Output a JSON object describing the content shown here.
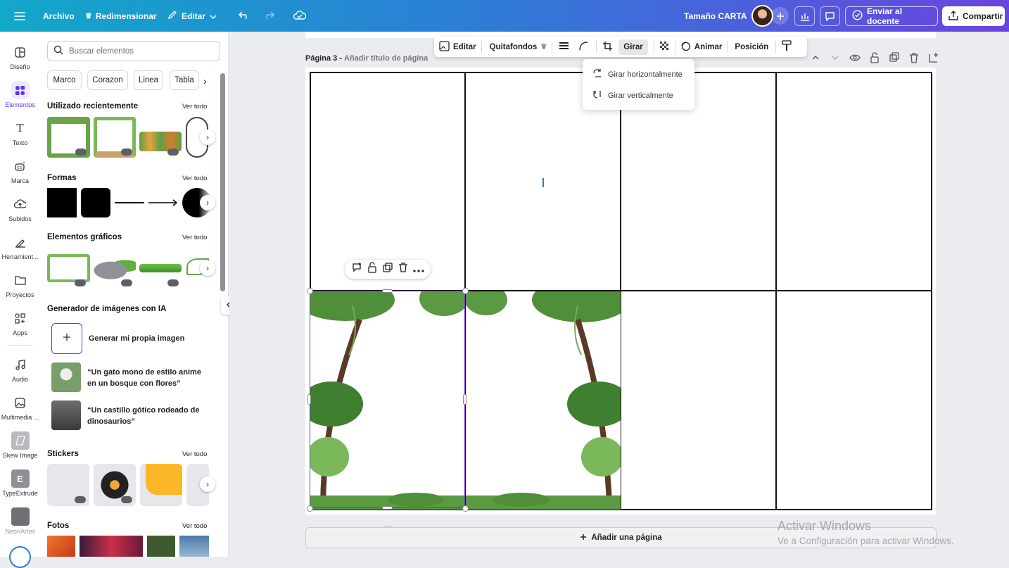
{
  "topbar": {
    "file": "Archivo",
    "resize": "Redimensionar",
    "edit": "Editar",
    "size_name": "Tamaño CARTA",
    "send": "Enviar al docente",
    "share": "Compartir"
  },
  "rail": [
    {
      "label": "Diseño",
      "icon": "layout-icon"
    },
    {
      "label": "Elementos",
      "icon": "elements-icon"
    },
    {
      "label": "Texto",
      "icon": "text-icon"
    },
    {
      "label": "Marca",
      "icon": "brand-icon"
    },
    {
      "label": "Subidos",
      "icon": "upload-icon"
    },
    {
      "label": "Herramient...",
      "icon": "tools-icon"
    },
    {
      "label": "Proyectos",
      "icon": "folder-icon"
    },
    {
      "label": "Apps",
      "icon": "apps-icon"
    },
    {
      "label": "Audio",
      "icon": "music-icon"
    },
    {
      "label": "Multimedia ...",
      "icon": "media-icon"
    },
    {
      "label": "Skew Image",
      "icon": "skew-icon"
    },
    {
      "label": "TypeExtrude",
      "icon": "typeextrude-icon"
    },
    {
      "label": "NeonArtist",
      "icon": "neonartist-icon"
    }
  ],
  "panel": {
    "search_placeholder": "Buscar elementos",
    "chips": [
      "Marco",
      "Corazon",
      "Linea",
      "Tabla"
    ],
    "recent_title": "Utilizado recientemente",
    "shapes_title": "Formas",
    "graphics_title": "Elementos gráficos",
    "ai_title": "Generador de imágenes con IA",
    "ai_generate": "Generar mi propia imagen",
    "ai_prompt1": "“Un gato mono de estilo anime en un bosque con flores”",
    "ai_prompt2": "“Un castillo gótico rodeado de dinosaurios”",
    "stickers_title": "Stickers",
    "photos_title": "Fotos",
    "see_all": "Ver todo"
  },
  "context_toolbar": {
    "edit": "Editar",
    "bg_remover": "Quitafondos",
    "rotate": "Girar",
    "animate": "Animar",
    "position": "Posición"
  },
  "rotate_menu": {
    "horizontal": "Girar horizontalmente",
    "vertical": "Girar verticalmente"
  },
  "page": {
    "label": "Página 3 -",
    "title_placeholder": "Añadir título de página",
    "add_page": "Añadir una página"
  },
  "watermark": {
    "line1": "Activar Windows",
    "line2": "Ve a Configuración para activar Windows."
  },
  "colors": {
    "accent": "#5a32fa",
    "topbar_start": "#12a8c9",
    "topbar_end": "#6a44e0"
  }
}
